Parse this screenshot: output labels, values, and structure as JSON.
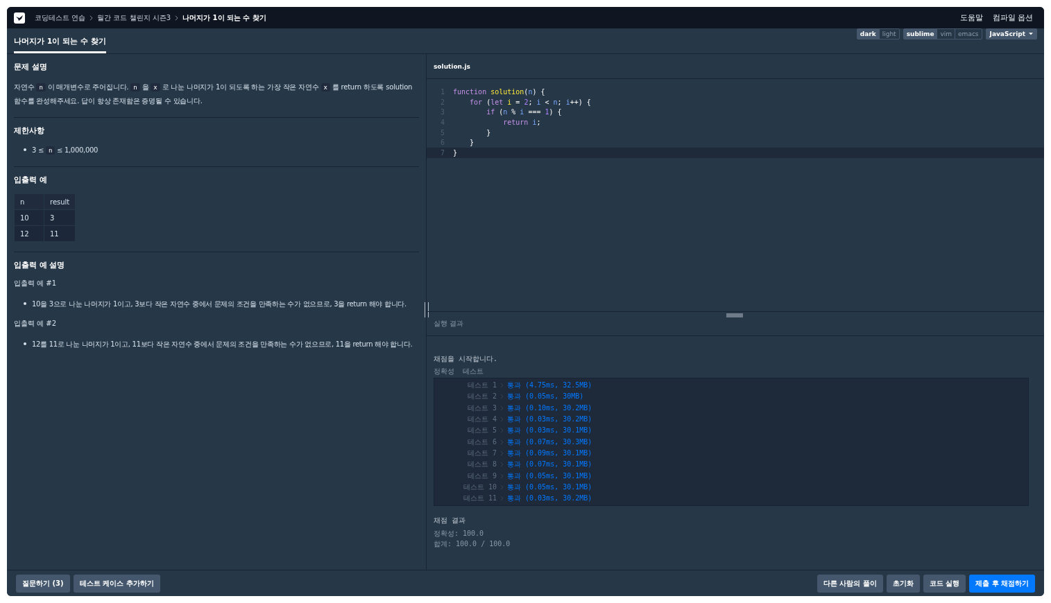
{
  "breadcrumbs": [
    {
      "label": "코딩테스트 연습",
      "current": false
    },
    {
      "label": "월간 코드 챌린지 시즌3",
      "current": false
    },
    {
      "label": "나머지가 1이 되는 수 찾기",
      "current": true
    }
  ],
  "top_links": [
    "도움말",
    "컴파일 옵션"
  ],
  "tabs": [
    {
      "label": "나머지가 1이 되는 수 찾기",
      "selected": true
    }
  ],
  "editor_options": [
    {
      "items": [
        {
          "label": "dark",
          "selected": true
        },
        {
          "label": "light",
          "selected": false
        }
      ]
    },
    {
      "items": [
        {
          "label": "sublime",
          "selected": true
        },
        {
          "label": "vim",
          "selected": false
        },
        {
          "label": "emacs",
          "selected": false
        }
      ]
    }
  ],
  "language": "JavaScript",
  "problem": {
    "description_title": "문제 설명",
    "description": [
      {
        "kind": "text",
        "text": "자연수"
      },
      {
        "kind": "code",
        "text": "n"
      },
      {
        "kind": "text",
        "text": "이 매개변수로 주어집니다."
      },
      {
        "kind": "code",
        "text": "n"
      },
      {
        "kind": "text",
        "text": "을"
      },
      {
        "kind": "code",
        "text": "x"
      },
      {
        "kind": "text",
        "text": "로 나눈 나머지가 1이 되도록 하는 가장 작은 자연수"
      },
      {
        "kind": "code",
        "text": "x"
      },
      {
        "kind": "text",
        "text": "를 return 하도록 solution 함수를 완성해주세요. 답이 항상 존재함은 증명될 수 있습니다."
      }
    ],
    "constraints_title": "제한사항",
    "constraints": [
      [
        {
          "kind": "text",
          "text": "3 ≤"
        },
        {
          "kind": "code",
          "text": "n"
        },
        {
          "kind": "text",
          "text": "≤ 1,000,000"
        }
      ]
    ],
    "examples_title": "입출력 예",
    "examples_table": {
      "columns": [
        "n",
        "result"
      ],
      "rows": [
        [
          "10",
          "3"
        ],
        [
          "12",
          "11"
        ]
      ]
    },
    "explanation_title": "입출력 예 설명",
    "explanations": [
      {
        "title": "입출력 예 #1",
        "items": [
          "10을 3으로 나눈 나머지가 1이고, 3보다 작은 자연수 중에서 문제의 조건을 만족하는 수가 없으므로, 3을 return 해야 합니다."
        ]
      },
      {
        "title": "입출력 예 #2",
        "items": [
          "12를 11로 나눈 나머지가 1이고, 11보다 작은 자연수 중에서 문제의 조건을 만족하는 수가 없으므로, 11을 return 해야 합니다."
        ]
      }
    ]
  },
  "editor": {
    "filename": "solution.js",
    "lines": [
      {
        "number": "1",
        "active": false,
        "tokens": [
          {
            "kind": "keyword",
            "text": "function"
          },
          {
            "kind": "fn",
            "text": " solution"
          },
          {
            "kind": "plain",
            "text": "("
          },
          {
            "kind": "var",
            "text": "n"
          },
          {
            "kind": "plain",
            "text": ") {"
          }
        ]
      },
      {
        "number": "2",
        "active": false,
        "tokens": [
          {
            "kind": "keyword",
            "text": "    for"
          },
          {
            "kind": "plain",
            "text": " ("
          },
          {
            "kind": "keyword",
            "text": "let"
          },
          {
            "kind": "fn",
            "text": " i"
          },
          {
            "kind": "plain",
            "text": " = "
          },
          {
            "kind": "num",
            "text": "2"
          },
          {
            "kind": "plain",
            "text": "; "
          },
          {
            "kind": "var",
            "text": "i"
          },
          {
            "kind": "plain",
            "text": " < "
          },
          {
            "kind": "var",
            "text": "n"
          },
          {
            "kind": "plain",
            "text": "; "
          },
          {
            "kind": "var",
            "text": "i"
          },
          {
            "kind": "plain",
            "text": "++) {"
          }
        ]
      },
      {
        "number": "3",
        "active": false,
        "tokens": [
          {
            "kind": "keyword",
            "text": "        if"
          },
          {
            "kind": "plain",
            "text": " ("
          },
          {
            "kind": "var",
            "text": "n"
          },
          {
            "kind": "plain",
            "text": " % "
          },
          {
            "kind": "var",
            "text": "i"
          },
          {
            "kind": "plain",
            "text": " === "
          },
          {
            "kind": "num",
            "text": "1"
          },
          {
            "kind": "plain",
            "text": ") {"
          }
        ]
      },
      {
        "number": "4",
        "active": false,
        "tokens": [
          {
            "kind": "keyword",
            "text": "            return"
          },
          {
            "kind": "var",
            "text": " i"
          },
          {
            "kind": "plain",
            "text": ";"
          }
        ]
      },
      {
        "number": "5",
        "active": false,
        "tokens": [
          {
            "kind": "plain",
            "text": "        }"
          }
        ]
      },
      {
        "number": "6",
        "active": false,
        "tokens": [
          {
            "kind": "plain",
            "text": "    }"
          }
        ]
      },
      {
        "number": "7",
        "active": true,
        "tokens": [
          {
            "kind": "plain",
            "text": "}"
          }
        ]
      }
    ]
  },
  "output": {
    "title": "실행 결과",
    "start": "채점을 시작합니다.",
    "section": "정확성  테스트",
    "tests": [
      {
        "label": "테스트 1",
        "status": "통과",
        "detail": "(4.75ms, 32.5MB)"
      },
      {
        "label": "테스트 2",
        "status": "통과",
        "detail": "(0.05ms, 30MB)"
      },
      {
        "label": "테스트 3",
        "status": "통과",
        "detail": "(0.10ms, 30.2MB)"
      },
      {
        "label": "테스트 4",
        "status": "통과",
        "detail": "(0.03ms, 30.2MB)"
      },
      {
        "label": "테스트 5",
        "status": "통과",
        "detail": "(0.03ms, 30.1MB)"
      },
      {
        "label": "테스트 6",
        "status": "통과",
        "detail": "(0.07ms, 30.3MB)"
      },
      {
        "label": "테스트 7",
        "status": "통과",
        "detail": "(0.09ms, 30.1MB)"
      },
      {
        "label": "테스트 8",
        "status": "통과",
        "detail": "(0.07ms, 30.1MB)"
      },
      {
        "label": "테스트 9",
        "status": "통과",
        "detail": "(0.05ms, 30.1MB)"
      },
      {
        "label": "테스트 10",
        "status": "통과",
        "detail": "(0.05ms, 30.1MB)"
      },
      {
        "label": "테스트 11",
        "status": "통과",
        "detail": "(0.03ms, 30.2MB)"
      }
    ],
    "summary_title": "채점 결과",
    "summary": [
      "정확성: 100.0",
      "합계: 100.0 / 100.0"
    ]
  },
  "left_buttons": [
    "질문하기 (3)",
    "테스트 케이스 추가하기"
  ],
  "right_buttons": [
    {
      "label": "다른 사람의 풀이",
      "primary": false
    },
    {
      "label": "초기화",
      "primary": false
    },
    {
      "label": "코드 실행",
      "primary": false
    },
    {
      "label": "제출 후 채점하기",
      "primary": true
    }
  ]
}
